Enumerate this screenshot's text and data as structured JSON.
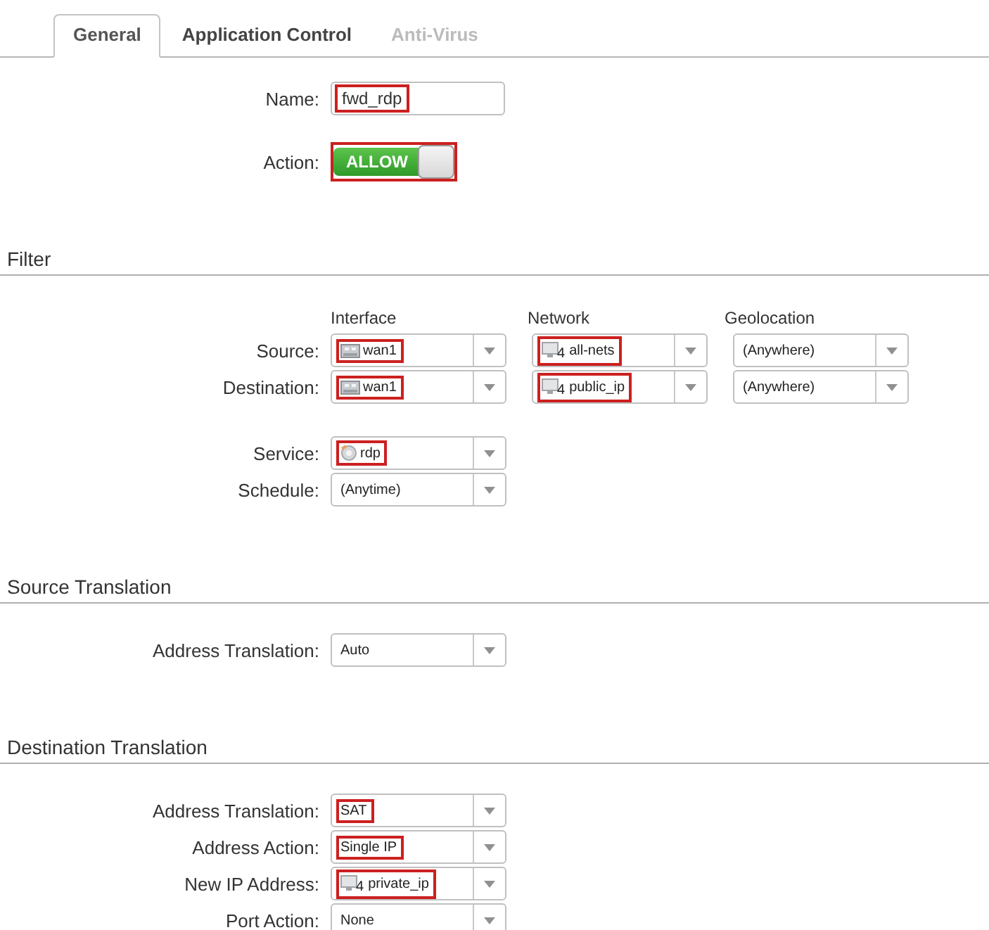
{
  "tabs": [
    {
      "label": "General",
      "selected": true,
      "disabled": false
    },
    {
      "label": "Application Control",
      "selected": false,
      "disabled": false
    },
    {
      "label": "Anti-Virus",
      "selected": false,
      "disabled": true
    }
  ],
  "name_field": {
    "label": "Name:",
    "value": "fwd_rdp",
    "highlighted": true
  },
  "action": {
    "label": "Action:",
    "value": "ALLOW",
    "on": true,
    "highlighted": true
  },
  "sections": [
    {
      "title": "Filter",
      "columns": [
        "Interface",
        "Network",
        "Geolocation"
      ],
      "groups": [
        [
          {
            "label": "Source:",
            "selects": [
              {
                "value": "wan1",
                "kind": "interface",
                "highlighted": true
              },
              {
                "value": "all-nets",
                "kind": "network",
                "badge": "4",
                "highlighted": true
              },
              {
                "value": "(Anywhere)",
                "highlighted": false
              }
            ]
          },
          {
            "label": "Destination:",
            "selects": [
              {
                "value": "wan1",
                "kind": "interface",
                "highlighted": true
              },
              {
                "value": "public_ip",
                "kind": "network",
                "badge": "4",
                "highlighted": true
              },
              {
                "value": "(Anywhere)",
                "highlighted": false
              }
            ]
          }
        ],
        [
          {
            "label": "Service:",
            "selects": [
              {
                "value": "rdp",
                "kind": "service",
                "highlighted": true
              }
            ]
          },
          {
            "label": "Schedule:",
            "selects": [
              {
                "value": "(Anytime)",
                "highlighted": false
              }
            ]
          }
        ]
      ]
    },
    {
      "title": "Source Translation",
      "groups": [
        [
          {
            "label": "Address Translation:",
            "selects": [
              {
                "value": "Auto",
                "highlighted": false
              }
            ]
          }
        ]
      ]
    },
    {
      "title": "Destination Translation",
      "groups": [
        [
          {
            "label": "Address Translation:",
            "selects": [
              {
                "value": "SAT",
                "highlighted": true
              }
            ]
          },
          {
            "label": "Address Action:",
            "selects": [
              {
                "value": "Single IP",
                "highlighted": true
              }
            ]
          },
          {
            "label": "New IP Address:",
            "selects": [
              {
                "value": "private_ip",
                "kind": "network",
                "badge": "4",
                "highlighted": true
              }
            ]
          },
          {
            "label": "Port Action:",
            "selects": [
              {
                "value": "None",
                "highlighted": false
              }
            ]
          }
        ]
      ]
    }
  ]
}
